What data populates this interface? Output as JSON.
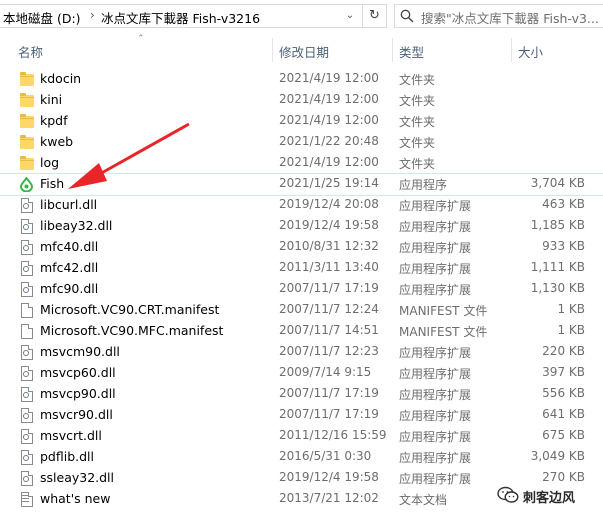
{
  "address_bar": {
    "segments": [
      "本地磁盘 (D:)",
      "冰点文库下載器 Fish-v3216"
    ],
    "separator": "›"
  },
  "search": {
    "placeholder": "搜索\"冰点文库下載器 Fish-v3..."
  },
  "columns": {
    "name": "名称",
    "date": "修改日期",
    "type": "类型",
    "size": "大小"
  },
  "files": [
    {
      "name": "kdocin",
      "date": "2021/4/19 12:00",
      "type": "文件夹",
      "size": "",
      "icon": "folder-icon"
    },
    {
      "name": "kini",
      "date": "2021/4/19 12:00",
      "type": "文件夹",
      "size": "",
      "icon": "folder-icon"
    },
    {
      "name": "kpdf",
      "date": "2021/4/19 12:00",
      "type": "文件夹",
      "size": "",
      "icon": "folder-icon"
    },
    {
      "name": "kweb",
      "date": "2021/1/22 20:48",
      "type": "文件夹",
      "size": "",
      "icon": "folder-icon"
    },
    {
      "name": "log",
      "date": "2021/4/19 12:00",
      "type": "文件夹",
      "size": "",
      "icon": "folder-icon"
    },
    {
      "name": "Fish",
      "date": "2021/1/25 19:14",
      "type": "应用程序",
      "size": "3,704 KB",
      "icon": "app-icon"
    },
    {
      "name": "libcurl.dll",
      "date": "2019/12/4 20:08",
      "type": "应用程序扩展",
      "size": "463 KB",
      "icon": "dll-icon"
    },
    {
      "name": "libeay32.dll",
      "date": "2019/12/4 19:58",
      "type": "应用程序扩展",
      "size": "1,185 KB",
      "icon": "dll-icon"
    },
    {
      "name": "mfc40.dll",
      "date": "2010/8/31 12:32",
      "type": "应用程序扩展",
      "size": "933 KB",
      "icon": "dll-icon"
    },
    {
      "name": "mfc42.dll",
      "date": "2011/3/11 13:40",
      "type": "应用程序扩展",
      "size": "1,111 KB",
      "icon": "dll-icon"
    },
    {
      "name": "mfc90.dll",
      "date": "2007/11/7 17:19",
      "type": "应用程序扩展",
      "size": "1,130 KB",
      "icon": "dll-icon"
    },
    {
      "name": "Microsoft.VC90.CRT.manifest",
      "date": "2007/11/7 12:24",
      "type": "MANIFEST 文件",
      "size": "1 KB",
      "icon": "file-icon"
    },
    {
      "name": "Microsoft.VC90.MFC.manifest",
      "date": "2007/11/7 14:51",
      "type": "MANIFEST 文件",
      "size": "1 KB",
      "icon": "file-icon"
    },
    {
      "name": "msvcm90.dll",
      "date": "2007/11/7 12:23",
      "type": "应用程序扩展",
      "size": "220 KB",
      "icon": "dll-icon"
    },
    {
      "name": "msvcp60.dll",
      "date": "2009/7/14 9:15",
      "type": "应用程序扩展",
      "size": "397 KB",
      "icon": "dll-icon"
    },
    {
      "name": "msvcp90.dll",
      "date": "2007/11/7 17:19",
      "type": "应用程序扩展",
      "size": "556 KB",
      "icon": "dll-icon"
    },
    {
      "name": "msvcr90.dll",
      "date": "2007/11/7 17:19",
      "type": "应用程序扩展",
      "size": "641 KB",
      "icon": "dll-icon"
    },
    {
      "name": "msvcrt.dll",
      "date": "2011/12/16 15:59",
      "type": "应用程序扩展",
      "size": "675 KB",
      "icon": "dll-icon"
    },
    {
      "name": "pdflib.dll",
      "date": "2016/5/31 0:30",
      "type": "应用程序扩展",
      "size": "3,049 KB",
      "icon": "dll-icon"
    },
    {
      "name": "ssleay32.dll",
      "date": "2019/12/4 19:58",
      "type": "应用程序扩展",
      "size": "270 KB",
      "icon": "dll-icon"
    },
    {
      "name": "what's new",
      "date": "2013/7/21 12:02",
      "type": "文本文档",
      "size": "",
      "icon": "text-file-icon"
    }
  ],
  "highlighted_file": "Fish",
  "watermark": {
    "text": "刺客边风"
  },
  "colors": {
    "annotation_arrow": "#e8262a",
    "folder": "#ffd766",
    "app_icon": "#3bb54a",
    "header_text": "#4c607a"
  }
}
